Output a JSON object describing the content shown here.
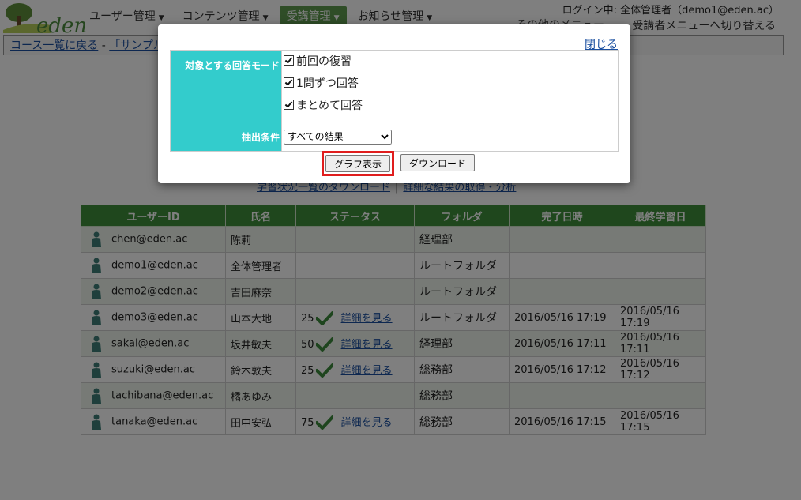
{
  "header": {
    "logo_text": "eden",
    "nav": [
      {
        "label": "ユーザー管理"
      },
      {
        "label": "コンテンツ管理"
      },
      {
        "label": "受講管理"
      },
      {
        "label": "お知らせ管理"
      }
    ],
    "login_text": "ログイン中: 全体管理者（demo1@eden.ac）",
    "other_menu": "その他のメニュー",
    "switch_menu": "受講者メニューへ切り替える"
  },
  "breadcrumb": {
    "back_link": "コース一覧に戻る",
    "sep": " - ",
    "course_partial": "「サンプルコ"
  },
  "links": {
    "download_status": "学習状況一覧のダウンロード",
    "detail_results": "詳細な結果の取得・分析"
  },
  "table": {
    "headers": [
      "ユーザーID",
      "氏名",
      "ステータス",
      "フォルダ",
      "完了日時",
      "最終学習日"
    ],
    "rows": [
      {
        "user_id": "chen@eden.ac",
        "name": "陈莉",
        "score": "",
        "detail": "",
        "folder": "経理部",
        "completed": "",
        "last": ""
      },
      {
        "user_id": "demo1@eden.ac",
        "name": "全体管理者",
        "score": "",
        "detail": "",
        "folder": "ルートフォルダ",
        "completed": "",
        "last": ""
      },
      {
        "user_id": "demo2@eden.ac",
        "name": "吉田麻奈",
        "score": "",
        "detail": "",
        "folder": "ルートフォルダ",
        "completed": "",
        "last": ""
      },
      {
        "user_id": "demo3@eden.ac",
        "name": "山本大地",
        "score": "25",
        "detail": "詳細を見る",
        "folder": "ルートフォルダ",
        "completed": "2016/05/16 17:19",
        "last": "2016/05/16 17:19"
      },
      {
        "user_id": "sakai@eden.ac",
        "name": "坂井敏夫",
        "score": "50",
        "detail": "詳細を見る",
        "folder": "経理部",
        "completed": "2016/05/16 17:11",
        "last": "2016/05/16 17:11"
      },
      {
        "user_id": "suzuki@eden.ac",
        "name": "鈴木敦夫",
        "score": "25",
        "detail": "詳細を見る",
        "folder": "総務部",
        "completed": "2016/05/16 17:12",
        "last": "2016/05/16 17:12"
      },
      {
        "user_id": "tachibana@eden.ac",
        "name": "橘あゆみ",
        "score": "",
        "detail": "",
        "folder": "総務部",
        "completed": "",
        "last": ""
      },
      {
        "user_id": "tanaka@eden.ac",
        "name": "田中安弘",
        "score": "75",
        "detail": "詳細を見る",
        "folder": "総務部",
        "completed": "2016/05/16 17:15",
        "last": "2016/05/16 17:15"
      }
    ]
  },
  "modal": {
    "close": "閉じる",
    "mode_label": "対象とする回答モード",
    "modes": [
      {
        "label": "前回の復習",
        "checked": true
      },
      {
        "label": "1問ずつ回答",
        "checked": true
      },
      {
        "label": "まとめて回答",
        "checked": true
      }
    ],
    "condition_label": "抽出条件",
    "condition_value": "すべての結果",
    "graph_button": "グラフ表示",
    "download_button": "ダウンロード"
  },
  "colors": {
    "header_green": "#3f8f3a",
    "form_label_teal": "#33cccc",
    "highlight_red": "#e01e1e",
    "link_blue": "#1a4fa0"
  }
}
